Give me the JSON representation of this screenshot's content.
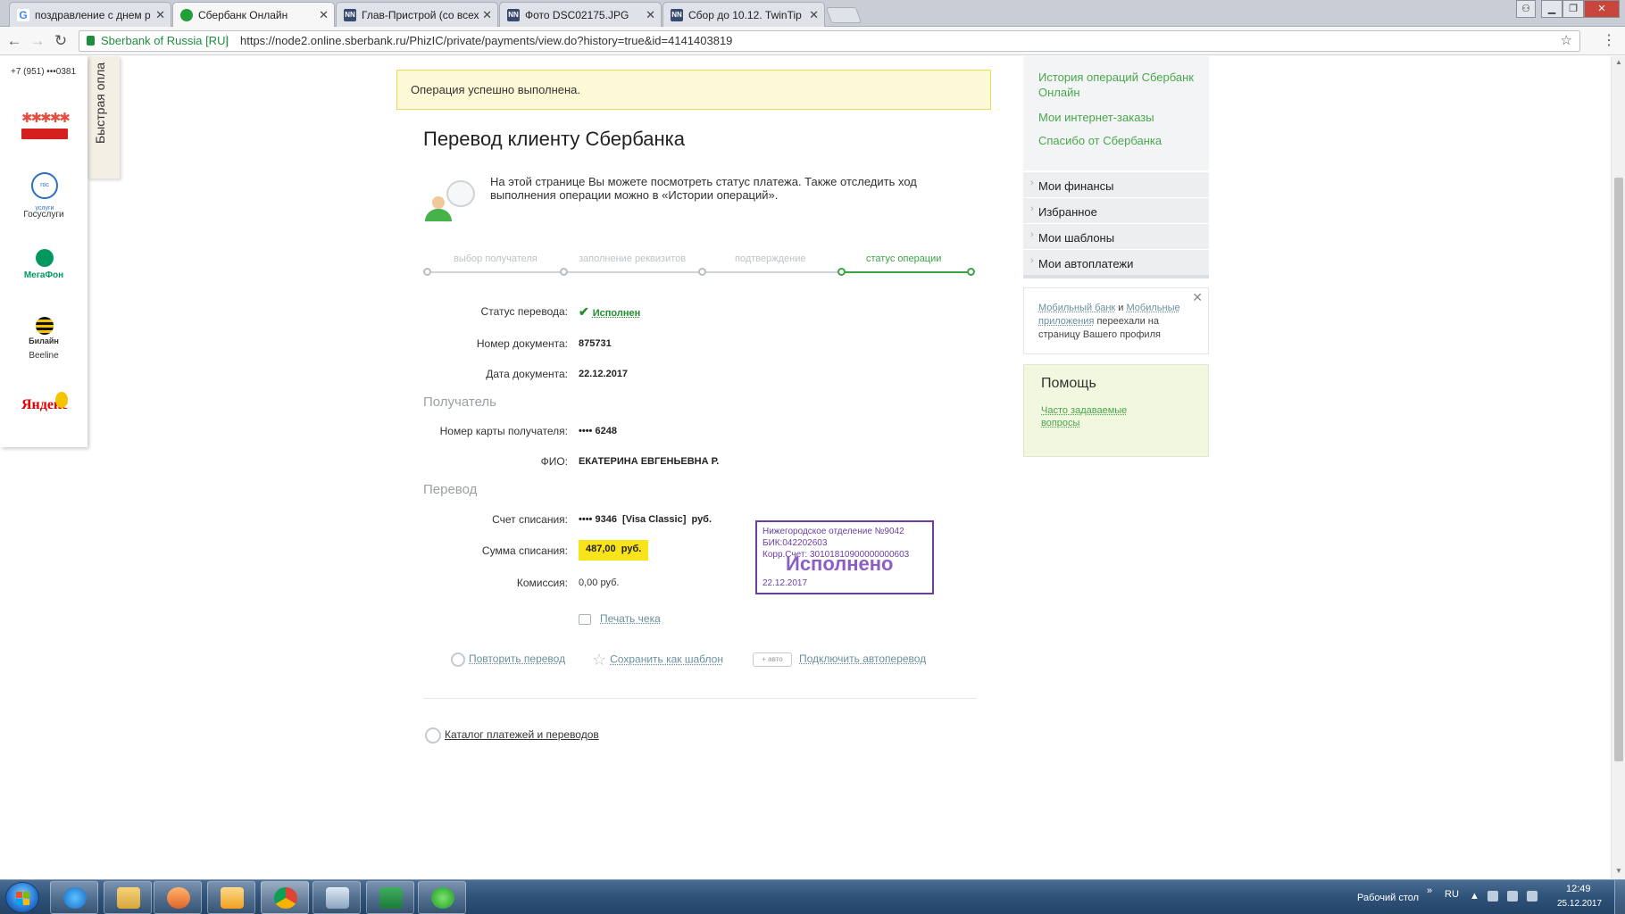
{
  "browser": {
    "tabs": [
      {
        "title": "поздравление с днем р",
        "icon": "google-icon",
        "active": false
      },
      {
        "title": "Сбербанк Онлайн",
        "icon": "sberbank-icon",
        "active": true
      },
      {
        "title": "Глав-Пристрой (со всех",
        "icon": "nn-icon",
        "active": false
      },
      {
        "title": "Фото DSC02175.JPG",
        "icon": "nn-icon",
        "active": false
      },
      {
        "title": "Сбор до 10.12. TwinTip",
        "icon": "nn-icon",
        "active": false
      }
    ],
    "favicons": {
      "google": "G",
      "nn": "NN"
    },
    "address": {
      "org": "Sberbank of Russia [RU]",
      "url": "https://node2.online.sberbank.ru/PhizIC/private/payments/view.do?history=true&id=4141403819"
    }
  },
  "quickpay": {
    "tab_label": "Быстрая опла",
    "phone": "+7 (951) •••0381",
    "items": [
      {
        "label": "",
        "icon": "charity-logo-icon"
      },
      {
        "label": "Госуслуги",
        "icon": "gosuslugi-icon",
        "logo_text": "гос услуги"
      },
      {
        "label": "",
        "icon": "megafon-icon",
        "logo_text": "МегаФон"
      },
      {
        "label": "Beeline",
        "icon": "beeline-icon",
        "logo_text": "Билайн"
      },
      {
        "label": "",
        "icon": "yandex-icon",
        "logo_text": "Яндекс"
      }
    ]
  },
  "main": {
    "success_message": "Операция успешно выполнена.",
    "title": "Перевод клиенту Сбербанка",
    "info_text": "На этой странице Вы можете посмотреть статус платежа. Также отследить ход выполнения операции можно в «Истории операций».",
    "steps": [
      "выбор получателя",
      "заполнение реквизитов",
      "подтверждение",
      "статус операции"
    ],
    "fields": {
      "status_label": "Статус перевода:",
      "status_value": "Исполнен",
      "doc_number_label": "Номер документа:",
      "doc_number_value": "875731",
      "doc_date_label": "Дата документа:",
      "doc_date_value": "22.12.2017"
    },
    "recipient_section": "Получатель",
    "recipient": {
      "card_label": "Номер карты получателя:",
      "card_value": "•••• 6248",
      "fio_label": "ФИО:",
      "fio_value": "ЕКАТЕРИНА ЕВГЕНЬЕВНА Р."
    },
    "transfer_section": "Перевод",
    "transfer": {
      "account_label": "Счет списания:",
      "account_value": "•••• 9346  [Visa Classic]  руб.",
      "sum_label": "Сумма списания:",
      "sum_value": "487,00  руб.",
      "commission_label": "Комиссия:",
      "commission_value": "0,00 руб."
    },
    "stamp": {
      "line1": "Нижегородское отделение №9042",
      "line2": "БИК:042202603",
      "line3": "Корр.Счет: 30101810900000000603",
      "big": "Исполнено",
      "date": "22.12.2017"
    },
    "print_label": "Печать чека",
    "actions": {
      "repeat": "Повторить перевод",
      "save_template": "Сохранить как шаблон",
      "auto_badge": "+ авто",
      "autopay": "Подключить автоперевод"
    },
    "catalog_link": "Каталог платежей и переводов"
  },
  "sidebar": {
    "links": [
      "История операций Сбербанк Онлайн",
      "Мои интернет-заказы",
      "Спасибо от Сбербанка"
    ],
    "menu": [
      "Мои финансы",
      "Избранное",
      "Мои шаблоны",
      "Мои автоплатежи"
    ],
    "notice": {
      "link1": "Мобильный банк",
      "and": " и ",
      "link2": "Мобильные приложения",
      "rest": " переехали на страницу Вашего профиля"
    },
    "help": {
      "title": "Помощь",
      "faq": "Часто задаваемые вопросы"
    }
  },
  "taskbar": {
    "desktop_label": "Рабочий стол",
    "lang": "RU",
    "time": "12:49",
    "date": "25.12.2017"
  }
}
